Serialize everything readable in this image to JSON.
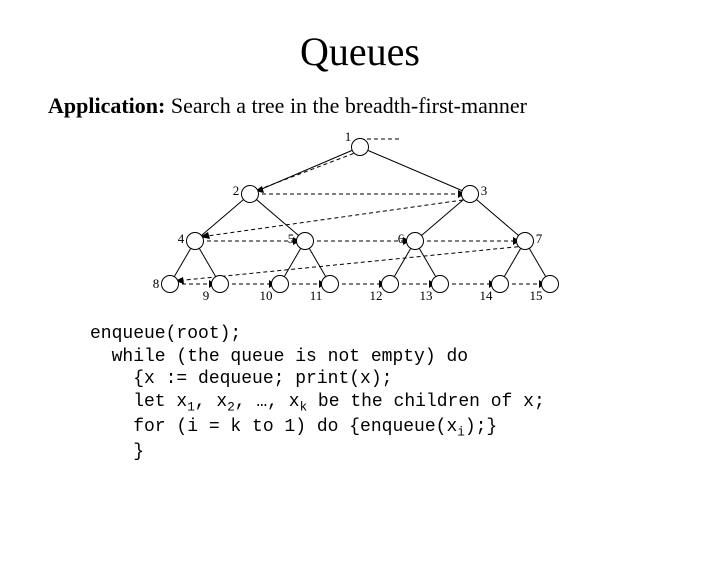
{
  "title": "Queues",
  "subtitle_bold": "Application:",
  "subtitle_rest": " Search a tree in the breadth-first-manner",
  "tree": {
    "nodes": [
      "1",
      "2",
      "3",
      "4",
      "5",
      "6",
      "7",
      "8",
      "9",
      "10",
      "11",
      "12",
      "13",
      "14",
      "15"
    ]
  },
  "code": {
    "l1": "enqueue(root);",
    "l2": "  while (the queue is not empty) do",
    "l3": "    {x := dequeue; print(x);",
    "l4a": "    let x",
    "l4b": ", x",
    "l4c": ", …, x",
    "l4d": " be the children of x;",
    "l5a": "    for (i = k to 1) do {enqueue(x",
    "l5b": ");}",
    "l6": "    }",
    "sub1": "1",
    "sub2": "2",
    "subk": "k",
    "subi": "i"
  }
}
